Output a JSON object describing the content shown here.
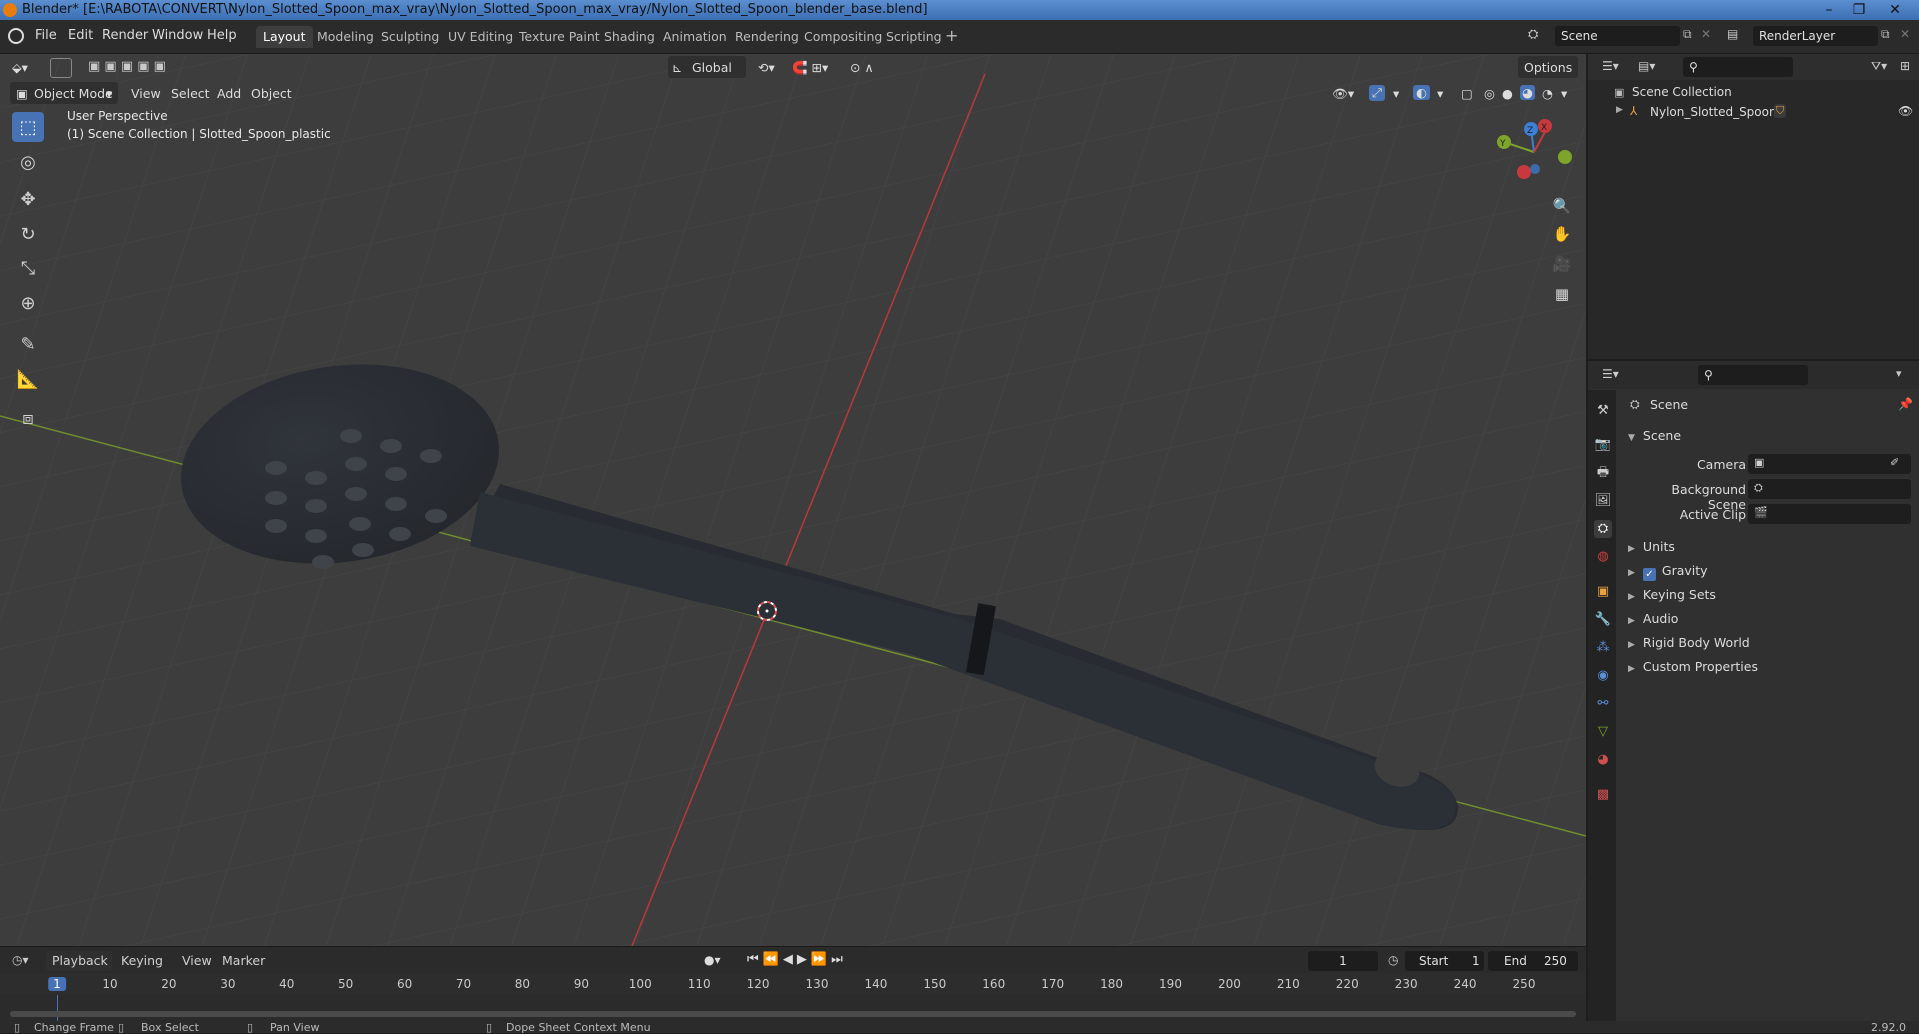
{
  "window": {
    "title": "Blender* [E:\\RABOTA\\CONVERT\\Nylon_Slotted_Spoon_max_vray\\Nylon_Slotted_Spoon_max_vray/Nylon_Slotted_Spoon_blender_base.blend]"
  },
  "menu": [
    "File",
    "Edit",
    "Render",
    "Window",
    "Help"
  ],
  "workspaces": [
    "Layout",
    "Modeling",
    "Sculpting",
    "UV Editing",
    "Texture Paint",
    "Shading",
    "Animation",
    "Rendering",
    "Compositing",
    "Scripting"
  ],
  "active_workspace": "Layout",
  "scene_field": "Scene",
  "renderlayer_field": "RenderLayer",
  "viewport": {
    "mode": "Object Mode",
    "menus": [
      "View",
      "Select",
      "Add",
      "Object"
    ],
    "transform_orientation": "Global",
    "options_label": "Options",
    "overlay_line1": "User Perspective",
    "overlay_line2": "(1) Scene Collection | Slotted_Spoon_plastic",
    "gizmo_axes": {
      "x": "X",
      "y": "Y",
      "z": "Z"
    }
  },
  "outliner": {
    "root": "Scene Collection",
    "items": [
      {
        "label": "Nylon_Slotted_Spoon"
      }
    ]
  },
  "properties": {
    "header_title": "Scene",
    "section": "Scene",
    "fields": [
      {
        "label": "Camera"
      },
      {
        "label": "Background Scene"
      },
      {
        "label": "Active Clip"
      }
    ],
    "panels": [
      "Units",
      "Gravity",
      "Keying Sets",
      "Audio",
      "Rigid Body World",
      "Custom Properties"
    ],
    "gravity_checked": true
  },
  "timeline": {
    "menus": [
      "Playback",
      "Keying",
      "View",
      "Marker"
    ],
    "current_frame": "1",
    "start_label": "Start",
    "start_value": "1",
    "end_label": "End",
    "end_value": "250",
    "ruler": [
      "1",
      "10",
      "20",
      "30",
      "40",
      "50",
      "60",
      "70",
      "80",
      "90",
      "100",
      "110",
      "120",
      "130",
      "140",
      "150",
      "160",
      "170",
      "180",
      "190",
      "200",
      "210",
      "220",
      "230",
      "240",
      "250"
    ]
  },
  "statusbar": {
    "items": [
      "Change Frame",
      "Box Select",
      "Pan View",
      "Dope Sheet Context Menu"
    ],
    "version": "2.92.0"
  },
  "colors": {
    "accent": "#4772b3",
    "x_axis": "#c8393e",
    "y_axis": "#7ea42b",
    "z_axis": "#3d7ed6",
    "spoon": "#2a2d33"
  }
}
